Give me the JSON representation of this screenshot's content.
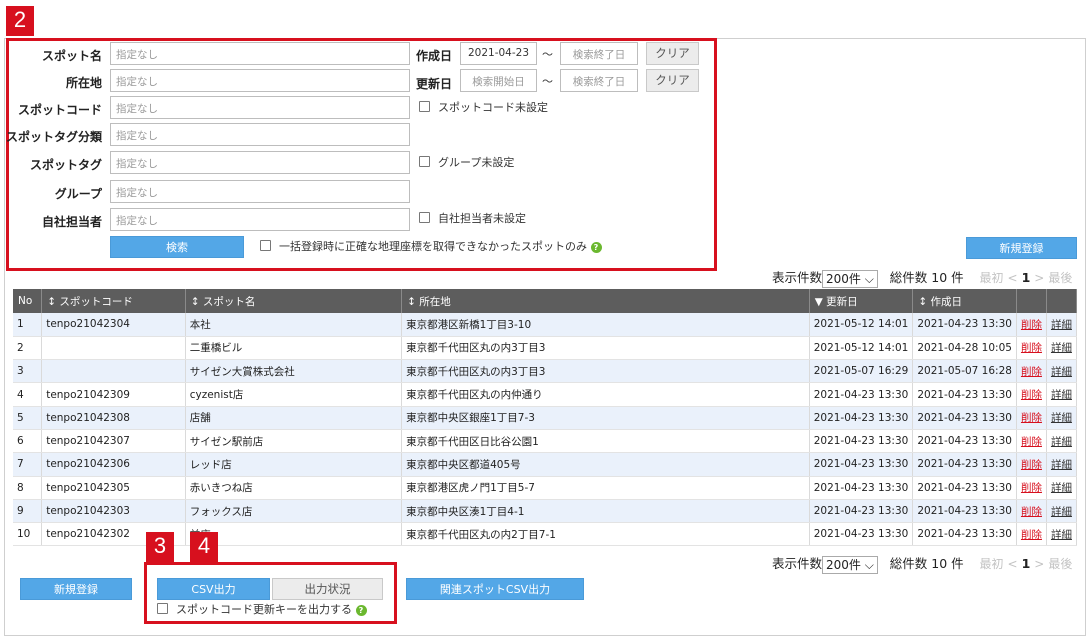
{
  "badges": {
    "b2": "2",
    "b3": "3",
    "b4": "4"
  },
  "search": {
    "fields": [
      {
        "label": "スポット名",
        "placeholder": "指定なし"
      },
      {
        "label": "所在地",
        "placeholder": "指定なし"
      },
      {
        "label": "スポットコード",
        "placeholder": "指定なし"
      },
      {
        "label": "スポットタグ分類",
        "placeholder": "指定なし"
      },
      {
        "label": "スポットタグ",
        "placeholder": "指定なし"
      },
      {
        "label": "グループ",
        "placeholder": "指定なし"
      },
      {
        "label": "自社担当者",
        "placeholder": "指定なし"
      }
    ],
    "created": {
      "label": "作成日",
      "from": "2021-04-23",
      "to_placeholder": "検索終了日",
      "clear": "クリア"
    },
    "updated": {
      "label": "更新日",
      "from_placeholder": "検索開始日",
      "to_placeholder": "検索終了日",
      "clear": "クリア"
    },
    "tilde": "〜",
    "checks": {
      "spot_code_unset": "スポットコード未設定",
      "group_unset": "グループ未設定",
      "owner_unset": "自社担当者未設定",
      "bad_geo": "一括登録時に正確な地理座標を取得できなかったスポットのみ"
    },
    "search_button": "検索",
    "help": "?"
  },
  "new_button": "新規登録",
  "pager": {
    "label": "表示件数",
    "per_page": "200件",
    "total": "総件数 10 件",
    "first": "最初",
    "prev": "<",
    "page": "1",
    "next": ">",
    "last": "最後"
  },
  "table": {
    "headers": [
      "No",
      "スポットコード",
      "スポット名",
      "所在地",
      "更新日",
      "作成日"
    ],
    "sort_icon": "↕",
    "sort_down_icon": "▼",
    "delete_label": "削除",
    "detail_label": "詳細",
    "rows": [
      {
        "no": "1",
        "code": "tenpo21042304",
        "name": "本社",
        "addr": "東京都港区新橋1丁目3-10",
        "updated": "2021-05-12 14:01",
        "created": "2021-04-23 13:30"
      },
      {
        "no": "2",
        "code": "",
        "name": "二重橋ビル",
        "addr": "東京都千代田区丸の内3丁目3",
        "updated": "2021-05-12 14:01",
        "created": "2021-04-28 10:05"
      },
      {
        "no": "3",
        "code": "",
        "name": "サイゼン大賞株式会社",
        "addr": "東京都千代田区丸の内3丁目3",
        "updated": "2021-05-07 16:29",
        "created": "2021-05-07 16:28"
      },
      {
        "no": "4",
        "code": "tenpo21042309",
        "name": "cyzenist店",
        "addr": "東京都千代田区丸の内仲通り",
        "updated": "2021-04-23 13:30",
        "created": "2021-04-23 13:30"
      },
      {
        "no": "5",
        "code": "tenpo21042308",
        "name": "店舗",
        "addr": "東京都中央区銀座1丁目7-3",
        "updated": "2021-04-23 13:30",
        "created": "2021-04-23 13:30"
      },
      {
        "no": "6",
        "code": "tenpo21042307",
        "name": "サイゼン駅前店",
        "addr": "東京都千代田区日比谷公園1",
        "updated": "2021-04-23 13:30",
        "created": "2021-04-23 13:30"
      },
      {
        "no": "7",
        "code": "tenpo21042306",
        "name": "レッド店",
        "addr": "東京都中央区都道405号",
        "updated": "2021-04-23 13:30",
        "created": "2021-04-23 13:30"
      },
      {
        "no": "8",
        "code": "tenpo21042305",
        "name": "赤いきつね店",
        "addr": "東京都港区虎ノ門1丁目5-7",
        "updated": "2021-04-23 13:30",
        "created": "2021-04-23 13:30"
      },
      {
        "no": "9",
        "code": "tenpo21042303",
        "name": "フォックス店",
        "addr": "東京都中央区湊1丁目4-1",
        "updated": "2021-04-23 13:30",
        "created": "2021-04-23 13:30"
      },
      {
        "no": "10",
        "code": "tenpo21042302",
        "name": "前店",
        "addr": "東京都千代田区丸の内2丁目7-1",
        "updated": "2021-04-23 13:30",
        "created": "2021-04-23 13:30"
      }
    ]
  },
  "bottom": {
    "csv_button": "CSV出力",
    "status_button": "出力状況",
    "related_csv_button": "関連スポットCSV出力",
    "update_key_check": "スポットコード更新キーを出力する"
  },
  "colors": {
    "accent_red": "#d7101e",
    "button_blue": "#53a7e7",
    "header_gray": "#5d5d5d",
    "row_blue": "#eaf1fb"
  }
}
